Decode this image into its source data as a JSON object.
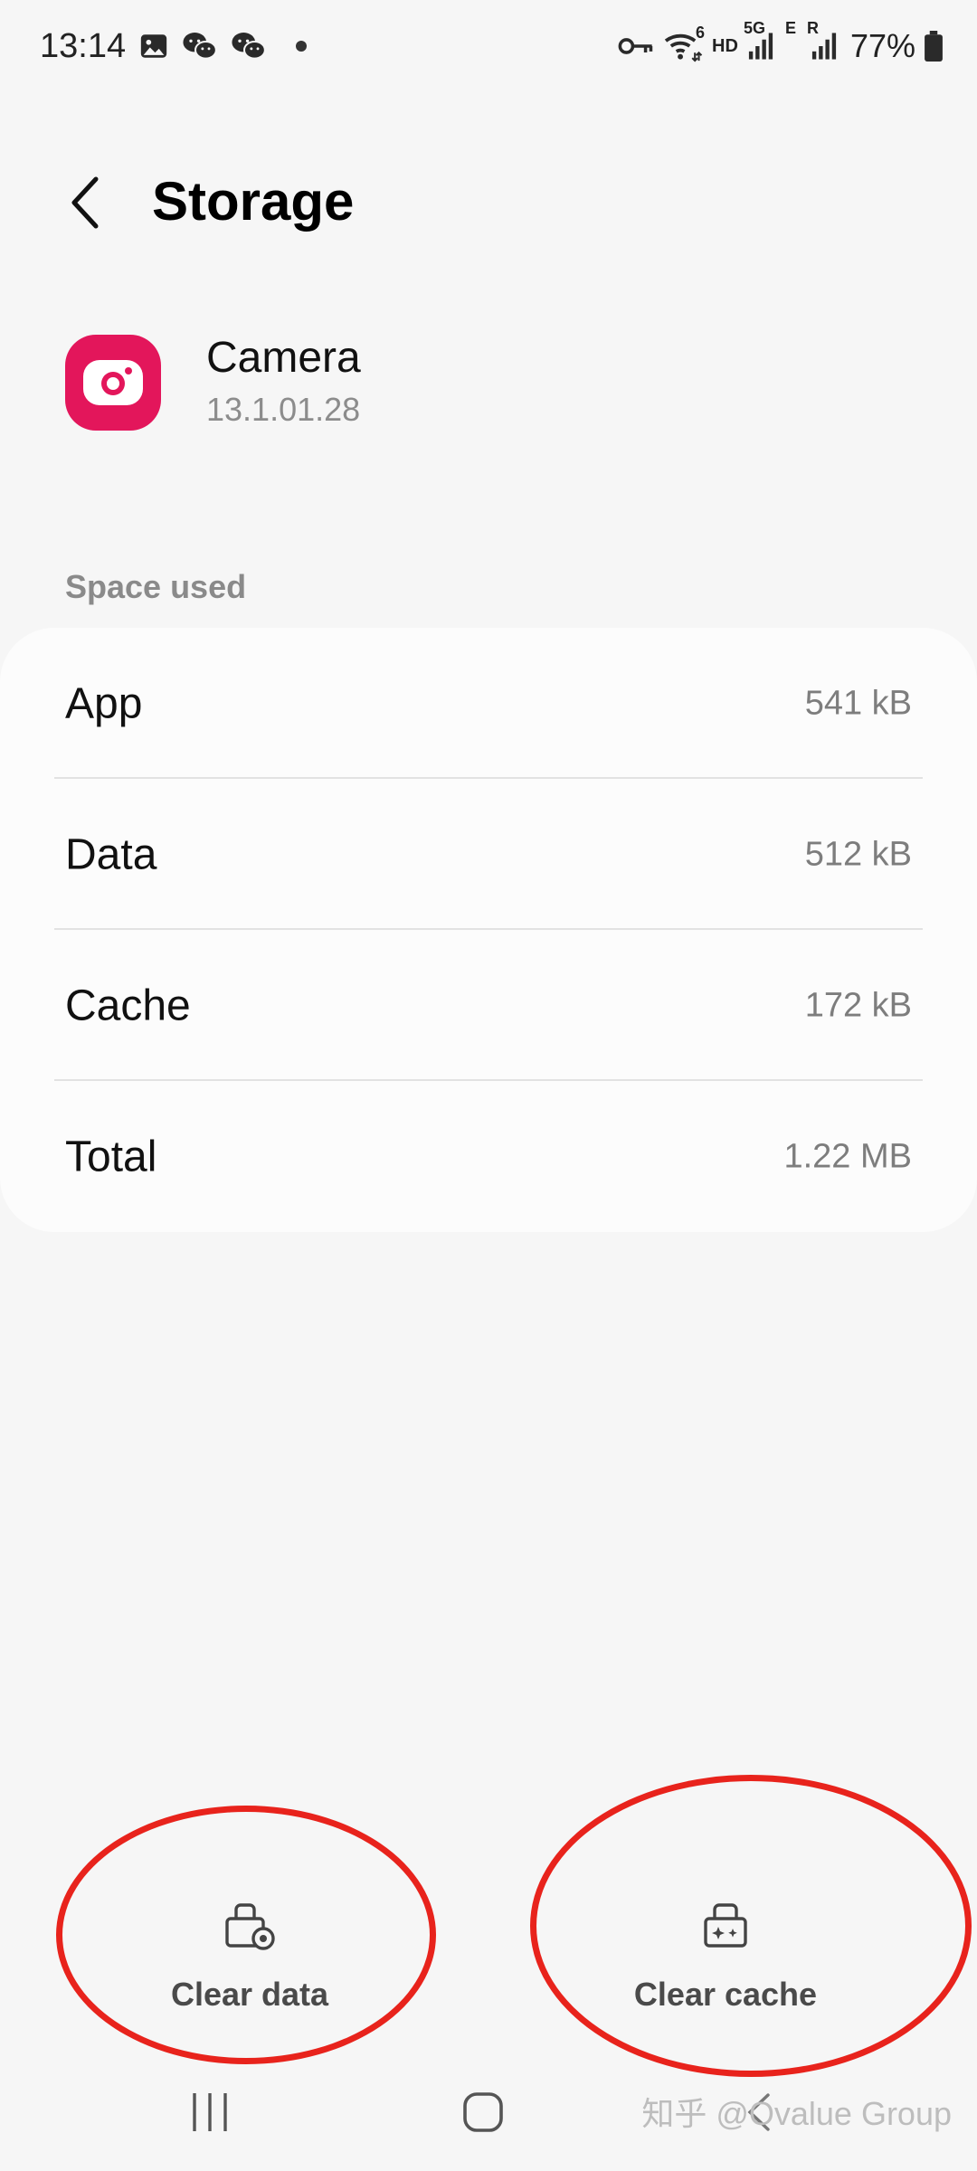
{
  "status_bar": {
    "time": "13:14",
    "left_icons": [
      "gallery-icon",
      "wechat-icon",
      "wechat-icon",
      "notification-dot"
    ],
    "right_icons": [
      "vpn-key-icon",
      "wifi-6-icon",
      "hd-icon",
      "5g-signal-icon",
      "e-signal-icon",
      "r-signal-icon"
    ],
    "wifi_badge": "6",
    "hd_label": "HD",
    "net_5g": "5G",
    "net_e": "E",
    "net_r": "R",
    "battery": "77%"
  },
  "header": {
    "back_icon": "chevron-left-icon",
    "title": "Storage"
  },
  "app": {
    "icon": "camera-icon",
    "icon_color": "#e3165b",
    "name": "Camera",
    "version": "13.1.01.28"
  },
  "space_used": {
    "label": "Space used",
    "rows": [
      {
        "label": "App",
        "value": "541 kB"
      },
      {
        "label": "Data",
        "value": "512 kB"
      },
      {
        "label": "Cache",
        "value": "172 kB"
      },
      {
        "label": "Total",
        "value": "1.22 MB"
      }
    ]
  },
  "actions": {
    "clear_data": {
      "icon": "clear-data-icon",
      "label": "Clear data"
    },
    "clear_cache": {
      "icon": "clear-cache-icon",
      "label": "Clear cache"
    }
  },
  "annotation_color": "#e8231c",
  "nav": {
    "items": [
      "recents-icon",
      "home-icon",
      "back-icon"
    ]
  },
  "watermark": "知乎 @Ovalue Group"
}
